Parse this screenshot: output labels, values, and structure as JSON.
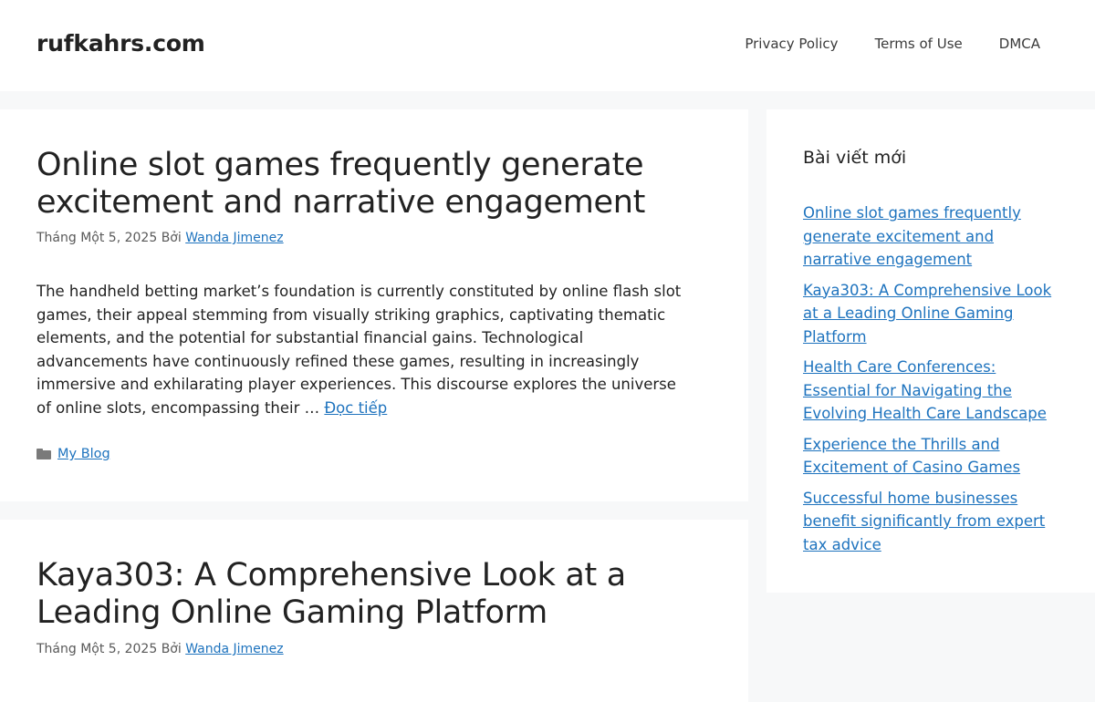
{
  "header": {
    "site_title": "rufkahrs.com",
    "nav": [
      "Privacy Policy",
      "Terms of Use",
      "DMCA"
    ]
  },
  "articles": [
    {
      "title": "Online slot games frequently generate excitement and narrative engagement",
      "date": "Tháng Một 5, 2025",
      "by": "Bởi",
      "author": "Wanda Jimenez",
      "summary": "The handheld betting market’s foundation is currently constituted by online flash slot games, their appeal stemming from visually striking graphics, captivating thematic elements, and the potential for substantial financial gains. Technological advancements have continuously refined these games, resulting in increasingly immersive and exhilarating player experiences. This discourse explores the universe of online slots, encompassing their …",
      "read_more": "Đọc tiếp",
      "category": "My Blog"
    },
    {
      "title": "Kaya303: A Comprehensive Look at a Leading Online Gaming Platform",
      "date": "Tháng Một 5, 2025",
      "by": "Bởi",
      "author": "Wanda Jimenez"
    }
  ],
  "sidebar": {
    "widget_title": "Bài viết mới",
    "recent_posts": [
      "Online slot games frequently generate excitement and narrative engagement",
      "Kaya303: A Comprehensive Look at a Leading Online Gaming Platform",
      "Health Care Conferences: Essential for Navigating the Evolving Health Care Landscape",
      "Experience the Thrills and Excitement of Casino Games",
      "Successful home businesses benefit significantly from expert tax advice"
    ]
  },
  "icons": {
    "category": "folder-icon"
  },
  "colors": {
    "link": "#1e73be",
    "background": "#f7f8f9",
    "text": "#222222"
  }
}
